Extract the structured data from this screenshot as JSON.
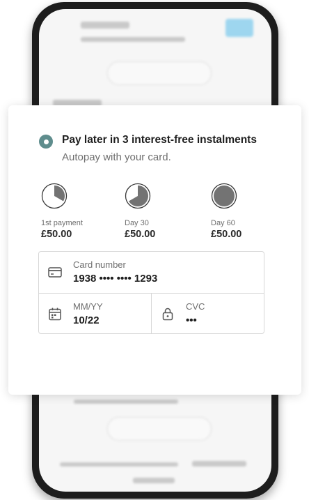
{
  "payment_option": {
    "title": "Pay later in 3 interest-free instalments",
    "subtitle": "Autopay with your card.",
    "accent_color": "#5f8d8d"
  },
  "installments": [
    {
      "label": "1st payment",
      "amount": "£50.00",
      "fraction_paid": 0.333,
      "icon": "pie-one-third-icon"
    },
    {
      "label": "Day 30",
      "amount": "£50.00",
      "fraction_paid": 0.667,
      "icon": "pie-two-thirds-icon"
    },
    {
      "label": "Day 60",
      "amount": "£50.00",
      "fraction_paid": 1.0,
      "icon": "pie-full-icon"
    }
  ],
  "card_form": {
    "card_number_label": "Card number",
    "card_number_value": "1938 •••• •••• 1293",
    "expiry_label": "MM/YY",
    "expiry_value": "10/22",
    "cvc_label": "CVC",
    "cvc_value": "•••",
    "icons": [
      "credit-card-icon",
      "calendar-icon",
      "lock-icon"
    ]
  }
}
